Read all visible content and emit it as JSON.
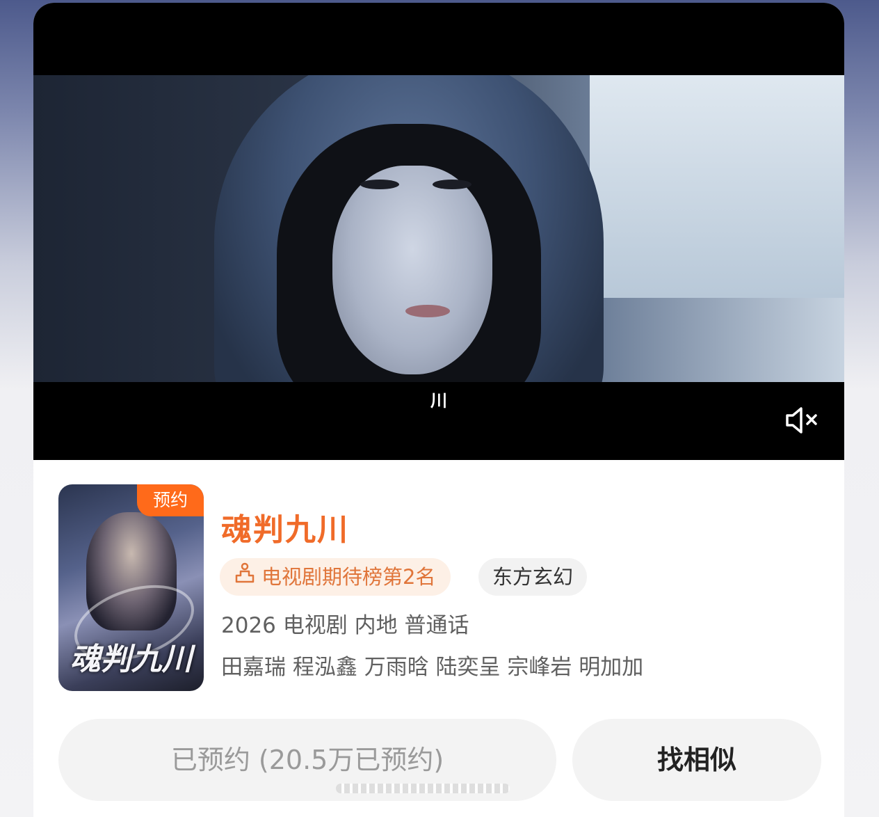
{
  "video": {
    "subtitle": "川",
    "mute_icon": "speaker-muted-icon"
  },
  "show": {
    "badge": "预约",
    "poster_art_title": "魂判九川",
    "title": "魂判九川",
    "rank_tag": "电视剧期待榜第2名",
    "rank_icon": "trophy-podium-icon",
    "genre_tag": "东方玄幻",
    "meta": "2026 电视剧 内地 普通话",
    "cast": "田嘉瑞 程泓鑫 万雨晗 陆奕呈 宗峰岩 明加加"
  },
  "actions": {
    "booked_label": "已预约 (20.5万已预约)",
    "similar_label": "找相似"
  },
  "colors": {
    "accent_orange": "#f06b29",
    "badge_orange": "#ff6a1a",
    "rank_tag_bg": "#fdf0e6"
  }
}
